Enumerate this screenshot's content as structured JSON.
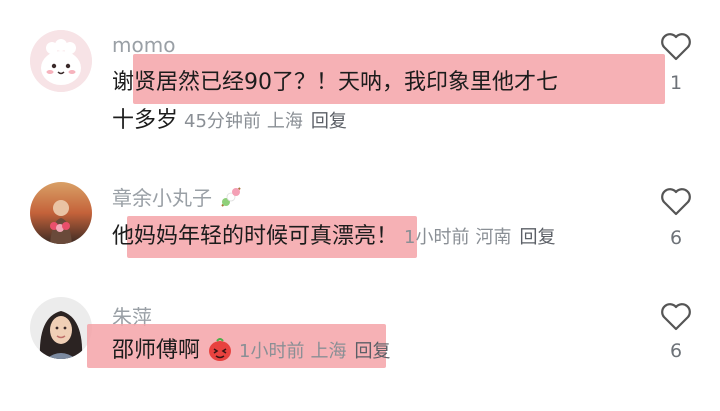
{
  "comments": [
    {
      "username": "momo",
      "text_line1": "谢贤居然已经90了？！天呐，我印象里他才七",
      "text_line2": "十多岁",
      "time": "45分钟前",
      "location": "上海",
      "reply": "回复",
      "likes": "1",
      "avatar_icon": "cartoon-avatar-icon"
    },
    {
      "username": "章余小丸子",
      "text": "他妈妈年轻的时候可真漂亮！",
      "time": "1小时前",
      "location": "河南",
      "reply": "回复",
      "likes": "6",
      "avatar_icon": "photo-avatar-icon",
      "name_emoji": "dango-icon"
    },
    {
      "username": "朱萍",
      "text": "邵师傅啊",
      "time": "1小时前",
      "location": "上海",
      "reply": "回复",
      "likes": "6",
      "avatar_icon": "photo-avatar-icon",
      "text_emoji": "shy-face-icon"
    }
  ],
  "colors": {
    "highlight": "#f4a3a8",
    "meta_text": "#8a8f95",
    "username_text": "#9aa0a6",
    "body_text": "#1c1c1c"
  }
}
